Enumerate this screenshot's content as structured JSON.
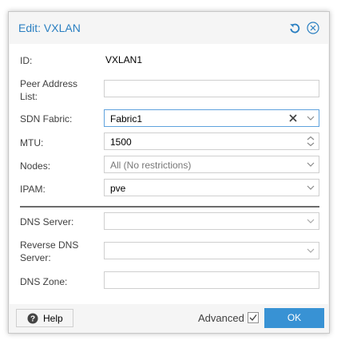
{
  "dialog": {
    "title": "Edit: VXLAN",
    "icons": {
      "reset": "undo-icon",
      "close": "close-circle-icon"
    }
  },
  "form": {
    "id": {
      "label": "ID:",
      "value": "VXLAN1"
    },
    "peers": {
      "label_line1": "Peer Address",
      "label_line2": "List:",
      "value": ""
    },
    "fabric": {
      "label": "SDN Fabric:",
      "value": "Fabric1"
    },
    "mtu": {
      "label": "MTU:",
      "value": "1500"
    },
    "nodes": {
      "label": "Nodes:",
      "value": "All (No restrictions)"
    },
    "ipam": {
      "label": "IPAM:",
      "value": "pve"
    },
    "dns": {
      "label": "DNS Server:",
      "value": ""
    },
    "reversedns": {
      "label_line1": "Reverse DNS",
      "label_line2": "Server:",
      "value": ""
    },
    "dnszone": {
      "label": "DNS Zone:",
      "value": ""
    }
  },
  "footer": {
    "help_label": "Help",
    "advanced_label": "Advanced",
    "advanced_checked": true,
    "ok_label": "OK"
  },
  "colors": {
    "accent": "#2a7fc1",
    "primary_button": "#3892d4",
    "focus_border": "#5fa2dd"
  }
}
